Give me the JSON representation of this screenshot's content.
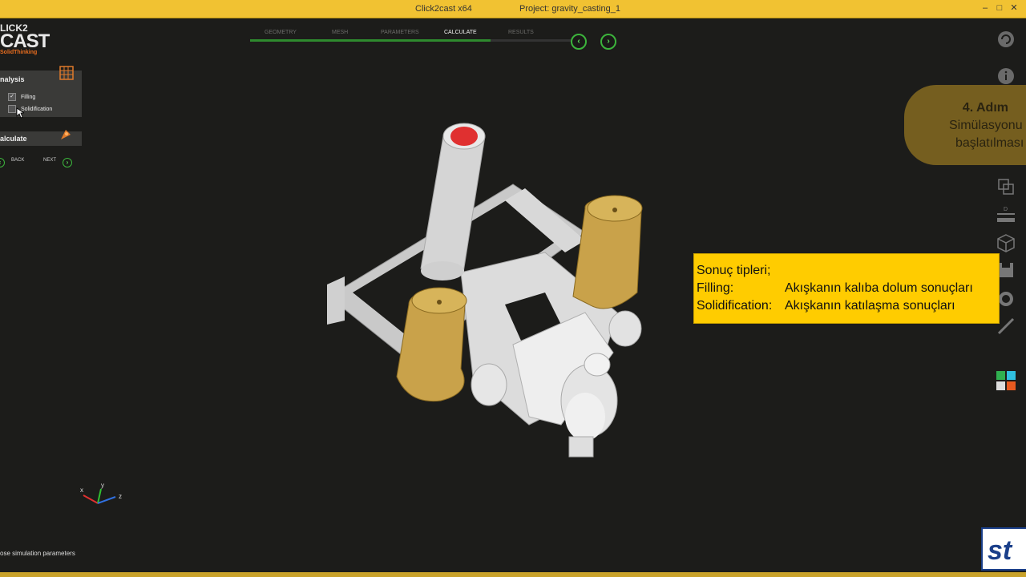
{
  "window": {
    "app_title": "Click2cast x64",
    "project_title": "Project: gravity_casting_1"
  },
  "logo": {
    "line1": "LICK2",
    "line2": "CAST",
    "line3": "SolidThinking"
  },
  "analysis_panel": {
    "title": "nalysis",
    "options": [
      {
        "label": "Filling",
        "checked": true,
        "mark": "✓"
      },
      {
        "label": "Solidification",
        "checked": false,
        "mark": ""
      }
    ]
  },
  "calculate_panel": {
    "title": "alculate",
    "back_label": "BACK",
    "next_label": "NEXT"
  },
  "workflow": {
    "steps": [
      "GEOMETRY",
      "MESH",
      "PARAMETERS",
      "CALCULATE",
      "RESULTS"
    ],
    "active": "CALCULATE"
  },
  "callout": {
    "title": "4. Adım",
    "line1": "Simülasyonu",
    "line2": "başlatılması"
  },
  "info_box": {
    "line1": "Sonuç tipleri;",
    "line2_key": "Filling:",
    "line2_value": "Akışkanın kalıba dolum sonuçları",
    "line3_key": "Solidification:",
    "line3_value": "Akışkanın katılaşma sonuçları"
  },
  "axes": {
    "x": "x",
    "y": "y",
    "z": "z"
  },
  "status_text": "ose simulation parameters",
  "window_controls": [
    "–",
    "□",
    "✕"
  ],
  "icons": [
    "refresh-icon",
    "info-icon",
    "undo-icon",
    "zoom-icon",
    "copy-icon",
    "measure-icon",
    "cube-icon",
    "save-icon",
    "camera-icon",
    "probe-icon",
    "color-grid-icon"
  ],
  "colors": {
    "accent": "#f1c232",
    "green": "#3cb43c",
    "callout": "#7a6220",
    "infobox": "#ffcc00"
  }
}
